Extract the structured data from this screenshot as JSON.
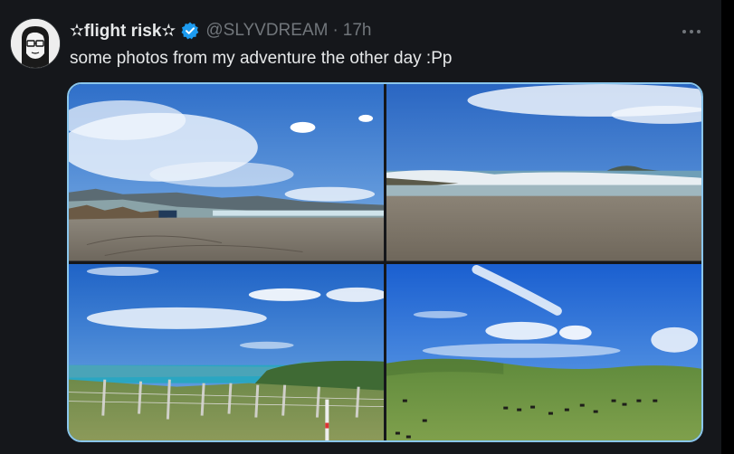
{
  "tweet": {
    "display_name": "✫flight risk✫",
    "handle": "@SLYVDREAM",
    "separator": "·",
    "time": "17h",
    "text": "some photos from my adventure the other day :Pp",
    "verified": true,
    "more_icon": "ellipsis-icon"
  },
  "media": {
    "photos": [
      {
        "name": "beach-photo-1",
        "scene": "beach"
      },
      {
        "name": "beach-photo-2",
        "scene": "beach-waves"
      },
      {
        "name": "coast-fence-photo",
        "scene": "coastal-hills"
      },
      {
        "name": "pasture-cows-photo",
        "scene": "hills-cattle"
      }
    ]
  },
  "colors": {
    "background": "#15171b",
    "accent": "#1d9bf0",
    "muted_text": "#71767b",
    "primary_text": "#e7e9ea",
    "media_border": "#8ac6ec"
  }
}
